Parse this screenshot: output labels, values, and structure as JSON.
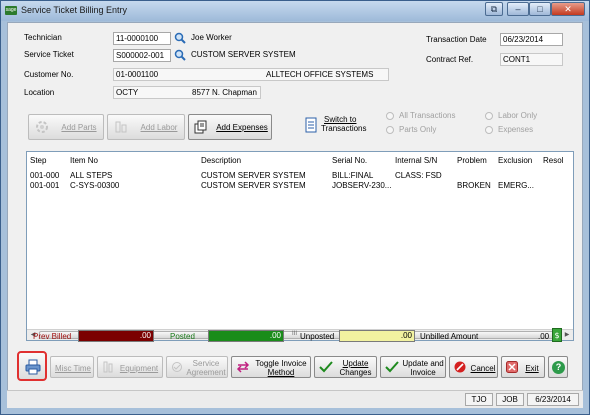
{
  "window": {
    "title": "Service Ticket Billing Entry",
    "app_icon": "sage",
    "controls": [
      "restore-down-icon",
      "minimize-icon",
      "maximize-icon",
      "close-icon"
    ]
  },
  "header": {
    "technician_label": "Technician",
    "technician_value": "11-0000100",
    "technician_name": "Joe Worker",
    "service_ticket_label": "Service Ticket",
    "service_ticket_value": "S000002-001",
    "service_ticket_desc": "CUSTOM SERVER SYSTEM",
    "customer_label": "Customer No.",
    "customer_value": "01-0001100",
    "customer_name": "ALLTECH OFFICE SYSTEMS",
    "location_label": "Location",
    "location_value": "OCTY",
    "location_address": "8577 N. Chapman",
    "transaction_date_label": "Transaction Date",
    "transaction_date_value": "06/23/2014",
    "contract_ref_label": "Contract Ref.",
    "contract_ref_value": "CONT1"
  },
  "toolbar": {
    "add_parts": "Add Parts",
    "add_labor": "Add Labor",
    "add_expenses": "Add Expenses",
    "switch_line1": "Switch to",
    "switch_line2": "Transactions",
    "radio_all": "All Transactions",
    "radio_parts": "Parts Only",
    "radio_labor": "Labor Only",
    "radio_expenses": "Expenses"
  },
  "grid": {
    "columns": [
      "Step",
      "Item No",
      "Description",
      "Serial No.",
      "Internal S/N",
      "Problem",
      "Exclusion",
      "Resol"
    ],
    "rows": [
      [
        "001-000",
        "ALL STEPS",
        "CUSTOM SERVER SYSTEM",
        "BILL:FINAL",
        "CLASS: FSD",
        "",
        "",
        ""
      ],
      [
        "001-001",
        "C-SYS-00300",
        "CUSTOM SERVER SYSTEM",
        "JOBSERV-230...",
        "",
        "BROKEN",
        "EMERG...",
        ""
      ]
    ],
    "scroll_thumb_glyph": "III"
  },
  "totals": {
    "prev_billed_label": "Prev Billed",
    "prev_billed_value": ".00",
    "posted_label": "Posted",
    "posted_value": ".00",
    "unposted_label": "Unposted",
    "unposted_value": ".00",
    "unbilled_label": "Unbilled Amount",
    "unbilled_value": ".00",
    "colors": {
      "prev_billed": "#7b0000",
      "posted": "#1a8c1a",
      "unposted": "#f2f2a0"
    }
  },
  "bottom_buttons": {
    "misc_time": "Misc Time",
    "equipment": "Equipment",
    "service_agreement_1": "Service",
    "service_agreement_2": "Agreement",
    "toggle_invoice_1": "Toggle Invoice",
    "toggle_invoice_2": "Method",
    "update_changes_1": "Update",
    "update_changes_2": "Changes",
    "update_invoice_1": "Update and",
    "update_invoice_2": "Invoice",
    "cancel": "Cancel",
    "exit": "Exit",
    "help": "?"
  },
  "status": {
    "user": "TJO",
    "company": "JOB",
    "date": "6/23/2014"
  }
}
